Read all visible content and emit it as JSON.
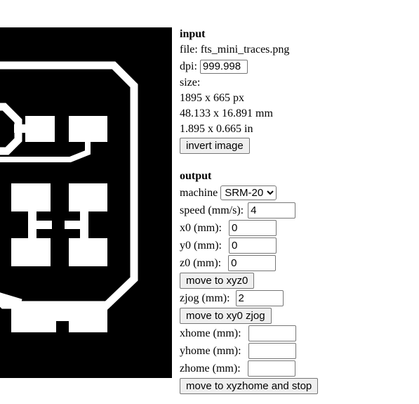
{
  "colors": {
    "canvas_background": "#000000",
    "trace": "#ffffff",
    "button_background": "#efefef",
    "control_border": "#767676"
  },
  "input": {
    "heading": "input",
    "file_label": "file:",
    "file_name": "fts_mini_traces.png",
    "dpi_label": "dpi:",
    "dpi_value": "999.998",
    "size_label": "size:",
    "size_px": "1895 x 665 px",
    "size_mm": "48.133 x 16.891 mm",
    "size_in": "1.895 x 0.665 in",
    "invert_button": "invert image"
  },
  "output": {
    "heading": "output",
    "machine_label": "machine",
    "machine_selected": "SRM-20",
    "speed_label": "speed (mm/s):",
    "speed_value": "4",
    "x0_label": "x0 (mm):",
    "x0_value": "0",
    "y0_label": "y0 (mm):",
    "y0_value": "0",
    "z0_label": "z0 (mm):",
    "z0_value": "0",
    "move_xyz0_button": "move to xyz0",
    "zjog_label": "zjog (mm):",
    "zjog_value": "2",
    "move_xy0_zjog_button": "move to xy0 zjog",
    "xhome_label": "xhome (mm):",
    "xhome_value": "",
    "yhome_label": "yhome (mm):",
    "yhome_value": "",
    "zhome_label": "zhome (mm):",
    "zhome_value": "",
    "move_home_stop_button": "move to xyzhome and stop"
  }
}
